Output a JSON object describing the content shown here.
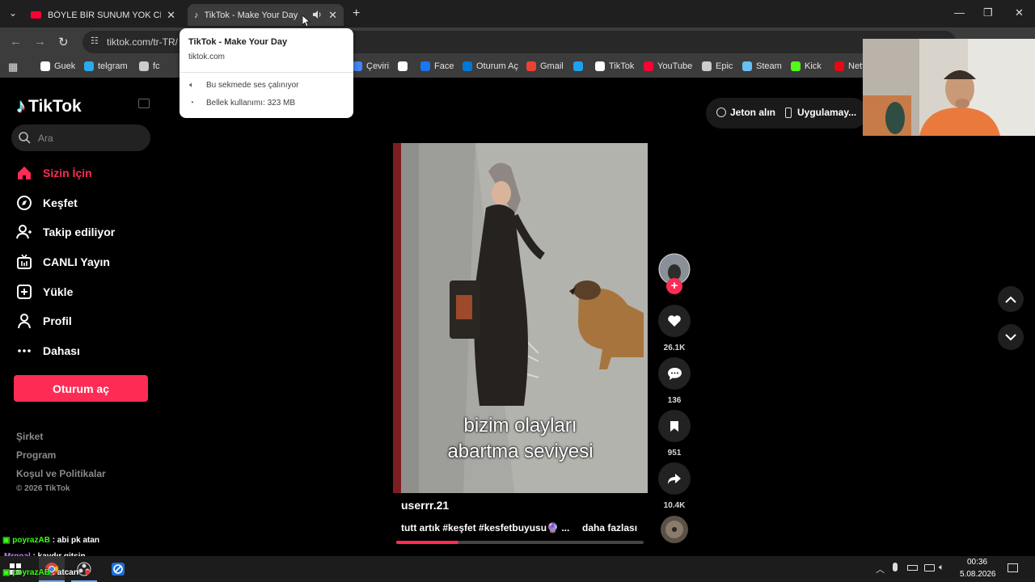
{
  "tabs": [
    {
      "title": "BÖYLE BİR SUNUM YOK CHEF C"
    },
    {
      "title": "TikTok - Make Your Day"
    }
  ],
  "address": {
    "url": "tiktok.com/tr-TR/"
  },
  "bookmarks": [
    {
      "label": "Guek",
      "color": "#ffffff"
    },
    {
      "label": "telgram",
      "color": "#2aabee"
    },
    {
      "label": "fc",
      "color": "#cccccc"
    },
    {
      "label": "Çeviri",
      "color": "#4285f4"
    },
    {
      "label": "",
      "color": "#ffffff"
    },
    {
      "label": "Face",
      "color": "#1877f2"
    },
    {
      "label": "Oturum Aç",
      "color": "#0078d4"
    },
    {
      "label": "Gmail",
      "color": "#ea4335"
    },
    {
      "label": "",
      "color": "#1da1f2"
    },
    {
      "label": "TikTok",
      "color": "#ffffff"
    },
    {
      "label": "YouTube",
      "color": "#ff0033"
    },
    {
      "label": "Epic",
      "color": "#cccccc"
    },
    {
      "label": "Steam",
      "color": "#66c0f4"
    },
    {
      "label": "Kick",
      "color": "#53fc18"
    },
    {
      "label": "Netfl",
      "color": "#e50914"
    }
  ],
  "tab_hover": {
    "title": "TikTok - Make Your Day",
    "domain": "tiktok.com",
    "audio": "Bu sekmede ses çalınıyor",
    "memory": "Bellek kullanımı: 323 MB"
  },
  "sidebar": {
    "logo": "TikTok",
    "search_placeholder": "Ara",
    "items": [
      {
        "label": "Sizin İçin",
        "active": true
      },
      {
        "label": "Keşfet"
      },
      {
        "label": "Takip ediliyor"
      },
      {
        "label": "CANLI Yayın"
      },
      {
        "label": "Yükle"
      },
      {
        "label": "Profil"
      },
      {
        "label": "Dahası"
      }
    ],
    "login": "Oturum aç",
    "footer": [
      "Şirket",
      "Program",
      "Koşul ve Politikalar"
    ],
    "copyright": "© 2026 TikTok"
  },
  "top_right": {
    "coins": "Jeton alın",
    "app": "Uygulamay..."
  },
  "video": {
    "caption_line1": "bizim olayları",
    "caption_line2": "abartma seviyesi",
    "username": "userrr.21",
    "description": "tutt artık #keşfet #kesfetbuyusu🔮 ...",
    "more": "daha fazlası",
    "progress": 0.25
  },
  "actions": {
    "likes": "26.1K",
    "comments": "136",
    "saves": "951",
    "shares": "10.4K"
  },
  "chat": [
    {
      "user": "poyrazAB",
      "user_color": "#39ff14",
      "text": " : abi pk atan"
    },
    {
      "user": "Mrgoal",
      "user_color": "#c77dff",
      "text": " : kaydır gitsin"
    },
    {
      "user": "poyrazAB",
      "user_color": "#39ff14",
      "text": " : atcan"
    }
  ],
  "taskbar": {
    "time": "00:36",
    "date": "5.08.2026"
  },
  "colors": {
    "accent": "#fe2c55",
    "background": "#000000"
  }
}
